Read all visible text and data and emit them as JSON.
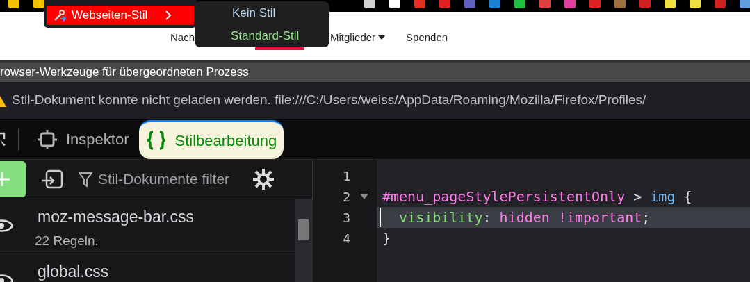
{
  "context_menu": {
    "item": {
      "label": "Webseiten-Stil",
      "highlighted": true
    },
    "submenu": [
      {
        "label": "Kein Stil",
        "selected": false
      },
      {
        "label": "Standard-Stil",
        "selected": true
      }
    ]
  },
  "web_page": {
    "nav": [
      {
        "label": "Nach",
        "dropdown": false
      },
      {
        "label": "Mitglieder",
        "dropdown": true
      },
      {
        "label": "Spenden",
        "dropdown": false
      }
    ]
  },
  "window": {
    "title": "rowser-Werkzeuge für übergeordneten Prozess"
  },
  "notification": {
    "text": "Stil-Dokument konnte nicht geladen werden. file:///C:/Users/weiss/AppData/Roaming/Mozilla/Firefox/Profiles/"
  },
  "tabs": [
    {
      "label": "Inspektor",
      "selected": false,
      "kind": "inspector"
    },
    {
      "label": "Stilbearbeitung",
      "selected": true,
      "kind": "style"
    }
  ],
  "sidebar": {
    "filter": {
      "placeholder": "Stil-Dokumente filter"
    },
    "items": [
      {
        "name": "moz-message-bar.css",
        "rules": "22 Regeln."
      },
      {
        "name": "global.css"
      }
    ]
  },
  "editor": {
    "lines": [
      {
        "number": "1",
        "foldable": false,
        "highlighted": false
      },
      {
        "number": "2",
        "foldable": true,
        "highlighted": false,
        "tokens": [
          {
            "text": "#menu_pageStylePersistentOnly",
            "kind": "selector"
          },
          {
            "text": " > ",
            "kind": "plain"
          },
          {
            "text": "img",
            "kind": "tag"
          },
          {
            "text": " {",
            "kind": "plain"
          }
        ]
      },
      {
        "number": "3",
        "foldable": false,
        "highlighted": true,
        "tokens": [
          {
            "text": "  visibility",
            "kind": "property"
          },
          {
            "text": ": ",
            "kind": "plain"
          },
          {
            "text": "hidden !important",
            "kind": "value"
          },
          {
            "text": ";",
            "kind": "plain"
          }
        ]
      },
      {
        "number": "4",
        "foldable": false,
        "highlighted": false,
        "tokens": [
          {
            "text": "}",
            "kind": "plain"
          }
        ]
      }
    ]
  }
}
